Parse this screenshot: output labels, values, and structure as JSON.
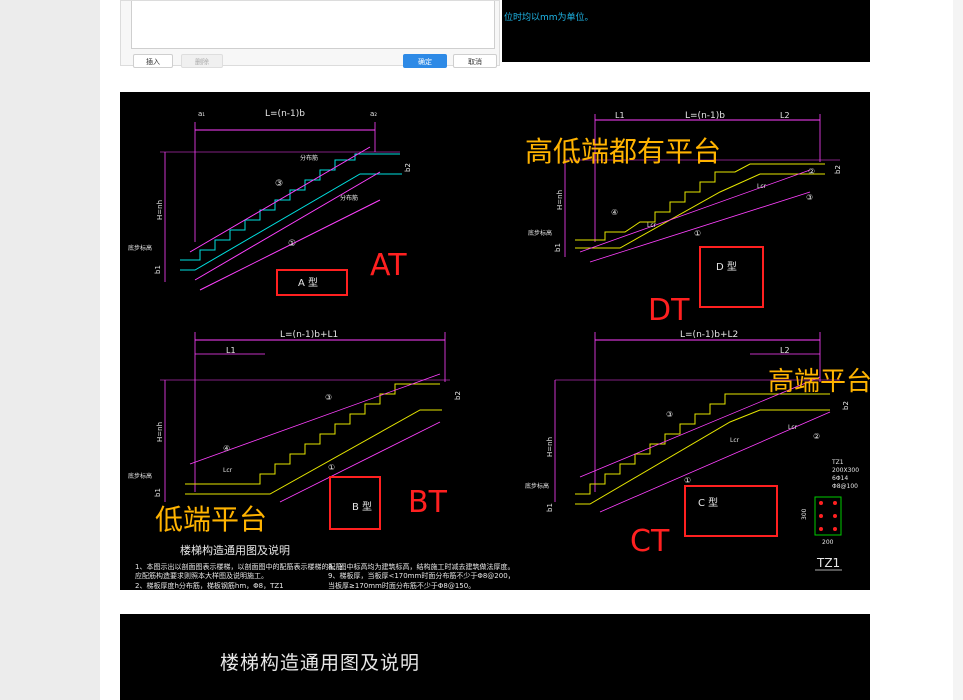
{
  "dialog": {
    "insert_label": "插入",
    "delete_label": "删除",
    "ok_label": "确定",
    "cancel_label": "取消"
  },
  "top_note": "位时均以mm为单位。",
  "cad": {
    "panel_a": {
      "span_label": "L=(n-1)b",
      "type_label": "A 型",
      "annotation": "AT",
      "rebar1": "分布筋",
      "rebar2": "分布筋",
      "marker1": "①",
      "marker3": "③",
      "left_label": "H=nh",
      "b1": "b1",
      "b2": "b2",
      "floor_label": "底步标高",
      "a1": "a₁",
      "a2": "a₂"
    },
    "panel_d": {
      "span_label": "L=(n-1)b",
      "l1": "L1",
      "l2": "L2",
      "type_label": "D 型",
      "annotation": "DT",
      "overlay": "高低端都有平台",
      "lcr1": "Lcr",
      "lcr2": "Lcr",
      "marker1": "①",
      "marker2": "②",
      "marker3": "③",
      "marker4": "④",
      "left_label": "H=nh",
      "b1": "b1",
      "b2": "b2",
      "floor_label": "底步标高"
    },
    "panel_b": {
      "span_label": "L=(n-1)b+L1",
      "l1": "L1",
      "type_label": "B 型",
      "annotation": "BT",
      "overlay": "低端平台",
      "lcr": "Lcr",
      "marker1": "①",
      "marker3": "③",
      "marker4": "④",
      "left_label": "H=nh",
      "b1": "b1",
      "b2": "b2",
      "floor_label": "底步标高"
    },
    "panel_c": {
      "span_label": "L=(n-1)b+L2",
      "l2": "L2",
      "type_label": "C 型",
      "annotation": "CT",
      "overlay": "高端平台",
      "lcr1": "Lcr",
      "lcr2": "Lcr",
      "marker1": "①",
      "marker2": "②",
      "marker3": "③",
      "left_label": "H=nh",
      "b1": "b1",
      "b2": "b2",
      "floor_label": "底步标高"
    },
    "tz1": {
      "label": "TZ1",
      "spec": [
        "TZ1",
        "200X300",
        "6Φ14",
        "Φ8@100"
      ],
      "dim1": "200",
      "dim2": "300"
    },
    "footer": {
      "title": "楼梯构造通用图及说明",
      "note1": "1、本图示出以剖面图表示楼梯，以剖面图中的配筋表示楼梯的配筋",
      "note1b": "   应配筋构造要求则照本大样图及说明施工。",
      "note2": "8、图中标高均为建筑标高，结构施工时减去建筑做法厚度。",
      "note2b": "9、梯板厚，当板厚<170mm时面分布筋不少于Φ8@200，",
      "note2c": "   当板厚≥170mm时面分布筋不少于Φ8@150。",
      "note3": "2、梯板厚度h分布筋，梯板钢筋hm，Φ8，TZ1"
    }
  },
  "bottom_title": "楼梯构造通用图及说明",
  "colors": {
    "red": "#ff2020",
    "orange": "#ffb300",
    "cyan": "#00e0e0",
    "yellow": "#e6e600",
    "magenta": "#ff40ff",
    "green": "#00cc00"
  }
}
